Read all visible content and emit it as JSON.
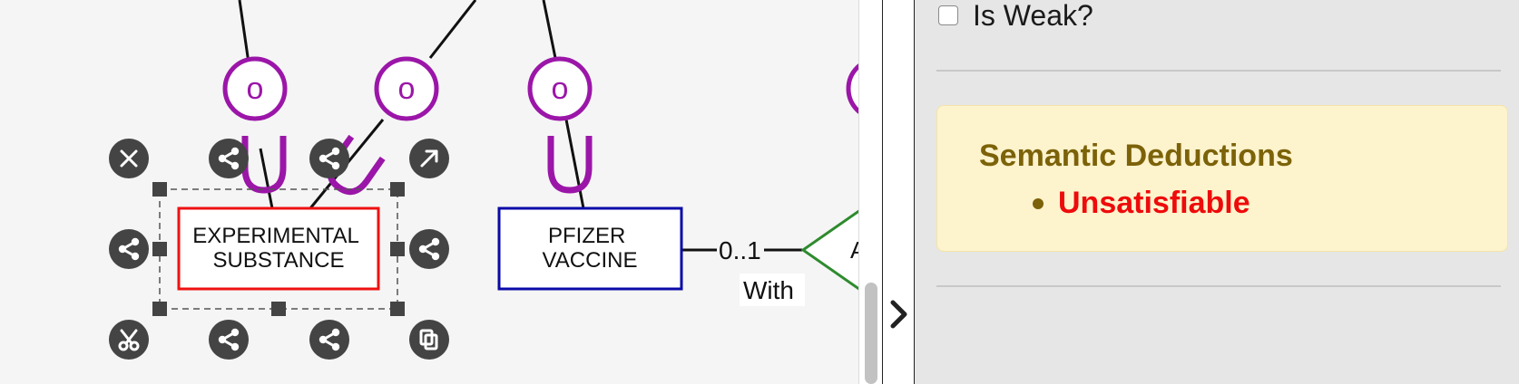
{
  "diagram": {
    "entities": [
      {
        "id": "experimental-substance",
        "lines": [
          "EXPERIMENTAL",
          "SUBSTANCE"
        ],
        "border": "#ee1111",
        "selected": true
      },
      {
        "id": "pfizer-vaccine",
        "lines": [
          "PFIZER",
          "VACCINE"
        ],
        "border": "#0a0aa8",
        "selected": false
      }
    ],
    "disjoint_marker": "o",
    "union_marker": "U",
    "relationship": {
      "cardinality": "0..1",
      "role": "With",
      "label_fragment": "A"
    },
    "colors": {
      "marker": "#9b16a8",
      "relationship": "#2e8b2e",
      "handle": "#444444"
    },
    "handle_icons": {
      "top": [
        "close-icon",
        "share-icon",
        "share-icon",
        "arrow-up-right-icon"
      ],
      "middle": [
        "share-icon",
        "share-icon"
      ],
      "bottom": [
        "scissors-icon",
        "share-icon",
        "share-icon",
        "copy-icon"
      ]
    }
  },
  "panel": {
    "is_weak": {
      "label": "Is Weak?",
      "checked": false
    },
    "deductions": {
      "title": "Semantic Deductions",
      "items": [
        "Unsatisfiable"
      ]
    }
  }
}
